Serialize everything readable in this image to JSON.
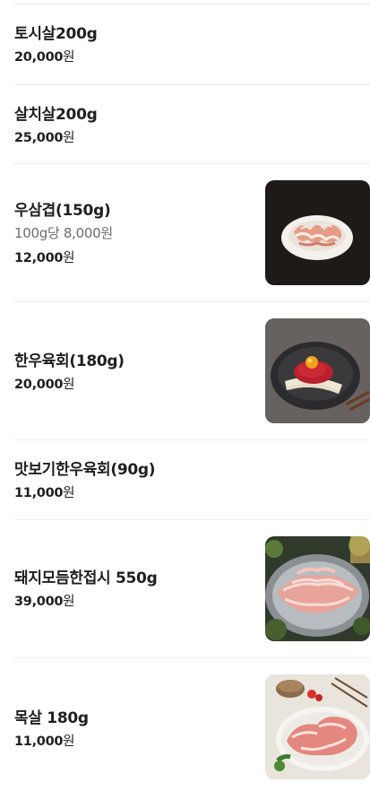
{
  "menu": {
    "items": [
      {
        "name": "토시살200g",
        "price": "20,000",
        "currency": "원"
      },
      {
        "name": "살치살200g",
        "price": "25,000",
        "currency": "원"
      },
      {
        "name": "우삼겹(150g)",
        "unit_price": "100g당 8,000원",
        "price": "12,000",
        "currency": "원",
        "image": "beef-plate-photo"
      },
      {
        "name": "한우육회(180g)",
        "price": "20,000",
        "currency": "원",
        "image": "yukhoe-photo"
      },
      {
        "name": "맛보기한우육회(90g)",
        "price": "11,000",
        "currency": "원"
      },
      {
        "name": "돼지모듬한접시 550g",
        "price": "39,000",
        "currency": "원",
        "image": "pork-platter-photo"
      },
      {
        "name": "목살 180g",
        "price": "11,000",
        "currency": "원",
        "image": "pork-neck-photo"
      }
    ]
  }
}
